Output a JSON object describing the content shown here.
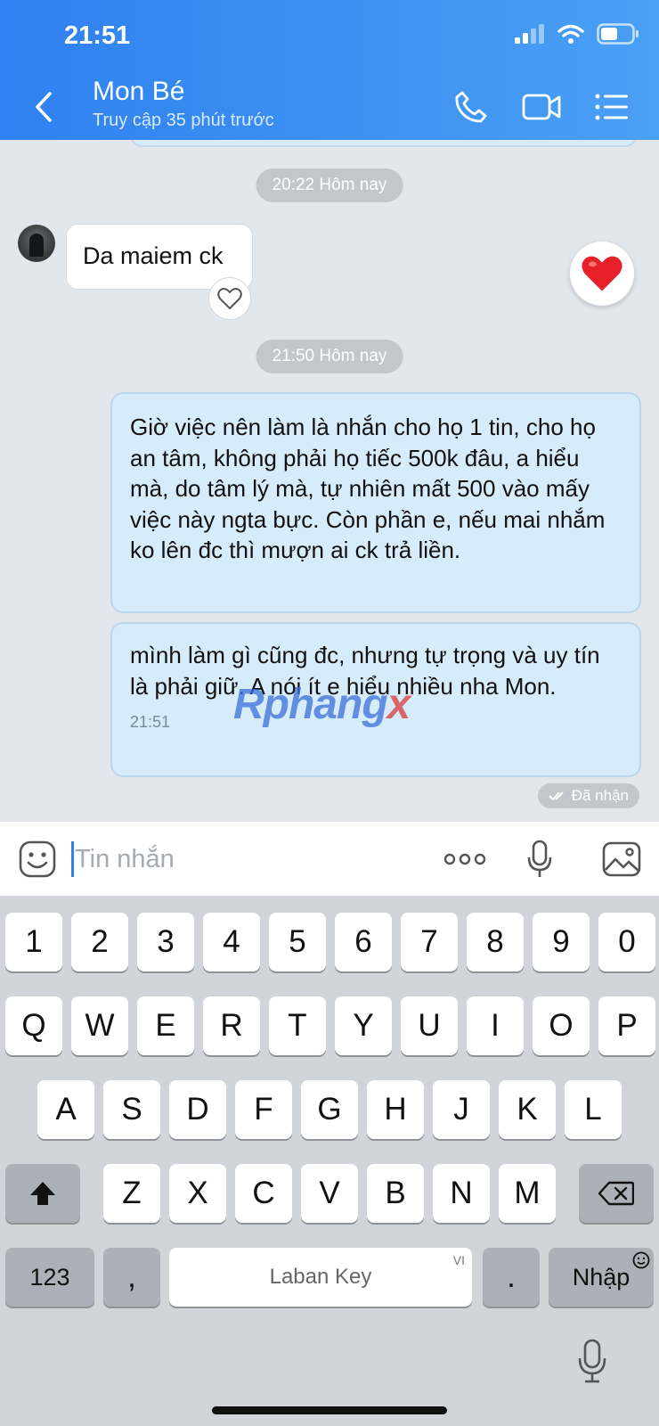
{
  "status_bar": {
    "time": "21:51"
  },
  "header": {
    "contact_name": "Mon Bé",
    "contact_status": "Truy cập 35 phút trước",
    "icons": [
      "back-icon",
      "phone-icon",
      "video-icon",
      "menu-icon"
    ]
  },
  "chat": {
    "time_divider_1": "20:22 Hôm nay",
    "incoming_message": "Da maiem ck",
    "time_divider_2": "21:50 Hôm nay",
    "outgoing_1": "Giờ việc nên làm là nhắn cho họ 1 tin, cho họ an tâm, không phải họ tiếc 500k đâu, a hiểu mà, do tâm lý mà, tự nhiên mất 500 vào mấy việc này ngta bực. Còn phần e, nếu mai nhắm ko lên đc thì mượn ai ck trả liền.",
    "outgoing_2": "mình làm gì cũng đc, nhưng tự trọng và uy tín là phải giữ. A nói ít e hiểu nhiều nha Mon.",
    "outgoing_2_time": "21:51",
    "read_status": "Đã nhận",
    "watermark_a": "Rphang",
    "watermark_b": "x"
  },
  "composer": {
    "placeholder": "Tin nhắn",
    "more_label": "ooo"
  },
  "keyboard": {
    "row_numbers": [
      "1",
      "2",
      "3",
      "4",
      "5",
      "6",
      "7",
      "8",
      "9",
      "0"
    ],
    "row_1": [
      "Q",
      "W",
      "E",
      "R",
      "T",
      "Y",
      "U",
      "I",
      "O",
      "P"
    ],
    "row_2": [
      "A",
      "S",
      "D",
      "F",
      "G",
      "H",
      "J",
      "K",
      "L"
    ],
    "row_3": [
      "Z",
      "X",
      "C",
      "V",
      "B",
      "N",
      "M"
    ],
    "mode_key": "123",
    "comma_key": ",",
    "space_label": "Laban Key",
    "space_lang": "VI",
    "period_key": ".",
    "enter_label": "Nhập"
  },
  "colors": {
    "header": "#2f80f0",
    "outgoing_bubble": "#d6ecfb",
    "chat_bg": "#e2e7ed",
    "heart": "#e8202a"
  }
}
